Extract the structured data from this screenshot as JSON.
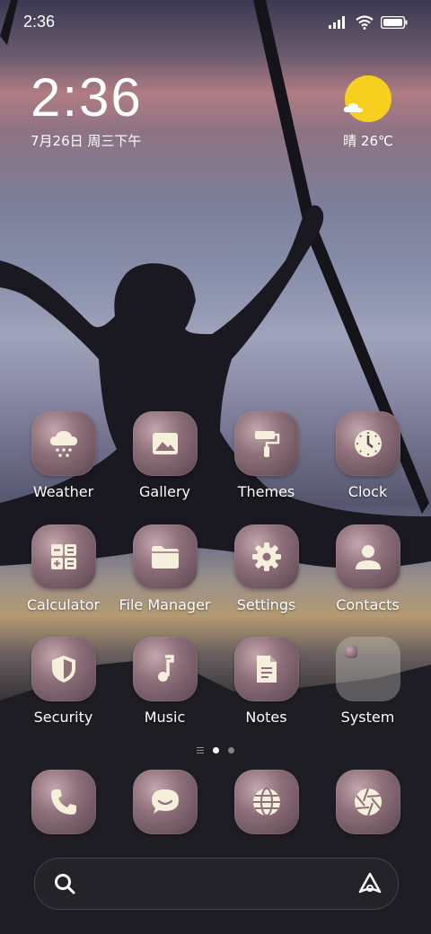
{
  "status": {
    "time": "2:36"
  },
  "clock": {
    "time": "2:36",
    "date": "7月26日 周三下午"
  },
  "weather": {
    "condition_temp": "晴 26℃",
    "sun_color": "#f7cf1f"
  },
  "apps": [
    {
      "label": "Weather",
      "icon": "cloud-snow-icon"
    },
    {
      "label": "Gallery",
      "icon": "image-icon"
    },
    {
      "label": "Themes",
      "icon": "paint-roller-icon"
    },
    {
      "label": "Clock",
      "icon": "clock-icon"
    },
    {
      "label": "Calculator",
      "icon": "calculator-icon"
    },
    {
      "label": "File Manager",
      "icon": "folder-icon"
    },
    {
      "label": "Settings",
      "icon": "gear-icon"
    },
    {
      "label": "Contacts",
      "icon": "person-icon"
    },
    {
      "label": "Security",
      "icon": "shield-icon"
    },
    {
      "label": "Music",
      "icon": "music-note-icon"
    },
    {
      "label": "Notes",
      "icon": "note-icon"
    },
    {
      "label": "System",
      "icon": "folder-group-icon"
    }
  ],
  "dock": [
    {
      "icon": "phone-icon"
    },
    {
      "icon": "message-icon"
    },
    {
      "icon": "globe-icon"
    },
    {
      "icon": "camera-aperture-icon"
    }
  ],
  "pager": {
    "pages": 2,
    "current": 1
  }
}
